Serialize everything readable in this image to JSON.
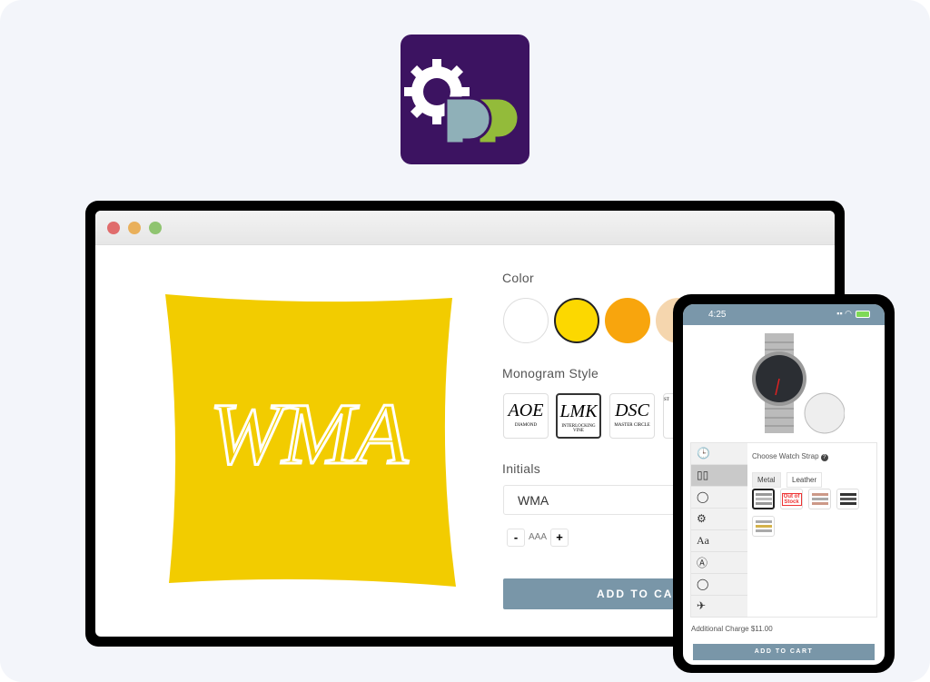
{
  "brand": {
    "logo_text": "PP",
    "colors": {
      "bg": "#3c1361",
      "p1": "#8fb0b8",
      "p2": "#93bb3a"
    }
  },
  "desktop": {
    "window_dots": [
      "#e06c6c",
      "#e9b05b",
      "#8fc470"
    ],
    "product": {
      "monogram": "WMA",
      "color": "#f2cc00"
    },
    "color_label": "Color",
    "colors": [
      {
        "hex": "#ffffff",
        "selected": false
      },
      {
        "hex": "#fcd800",
        "selected": true
      },
      {
        "hex": "#f8a50d",
        "selected": false
      },
      {
        "hex": "#f5d6ae",
        "selected": false
      }
    ],
    "monogram_label": "Monogram Style",
    "monogram_styles": [
      {
        "glyph": "AOE",
        "caption": "Diamond",
        "selected": false
      },
      {
        "glyph": "LMK",
        "caption": "Interlocking Vine",
        "selected": true
      },
      {
        "glyph": "DSC",
        "caption": "Master Circle",
        "selected": false
      },
      {
        "glyph": "",
        "caption": "St",
        "selected": false
      }
    ],
    "initials_label": "Initials",
    "initials_value": "WMA",
    "size_minus": "-",
    "size_label": "AAA",
    "size_plus": "+",
    "add_to_cart": "ADD TO CART"
  },
  "mobile": {
    "time": "4:25",
    "tabs": [
      "clock",
      "strap",
      "ring",
      "gears",
      "Aa",
      "A",
      "bezel",
      "plane"
    ],
    "active_tab": 1,
    "section_title": "Choose Watch Strap",
    "help": "?",
    "options": [
      "Metal",
      "Leather"
    ],
    "selected_option": "Metal",
    "out_of_stock": "Out of Stock",
    "additional_charge": "Additional Charge $11.00",
    "add_to_cart": "ADD TO CART"
  }
}
